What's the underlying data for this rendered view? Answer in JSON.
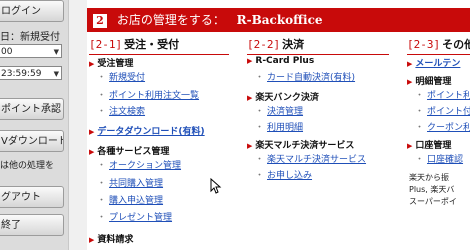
{
  "sidebar": {
    "login_label": "ログイン",
    "new_order_label": "日：新規受付",
    "date_value": "00",
    "time_value": "23:59:59",
    "point_approval_label": "ポイント承認",
    "download_label": "Vダウンロード",
    "note_text": "は他の処理を",
    "logout_label": "グアウト",
    "exit_label": "終了"
  },
  "header": {
    "number": "2",
    "title": "お店の管理をする：",
    "brand": "R-Backoffice"
  },
  "columns": [
    {
      "code": "[2-1]",
      "name": "受注・受付",
      "groups": [
        {
          "label": "受注管理",
          "links": [
            "新規受付",
            "ポイント利用注文一覧",
            "注文検索"
          ]
        },
        {
          "label": "データダウンロード(有料)",
          "links": []
        },
        {
          "label": "各種サービス管理",
          "links": [
            "オークション管理",
            "共同購入管理",
            "購入申込管理",
            "プレゼント管理"
          ]
        },
        {
          "label": "資料請求",
          "links": []
        }
      ]
    },
    {
      "code": "[2-2]",
      "name": "決済",
      "groups": [
        {
          "label": "R-Card Plus",
          "links": [
            "カード自動決済(有料)"
          ]
        },
        {
          "label": "楽天バンク決済",
          "links": [
            "決済管理",
            "利用明細"
          ]
        },
        {
          "label": "楽天マルチ決済サービス",
          "links": [
            "楽天マルチ決済サービス",
            "お申し込み"
          ]
        }
      ]
    },
    {
      "code": "[2-3]",
      "name": "その他",
      "groups": [
        {
          "label": "メールテン",
          "links": []
        },
        {
          "label": "明細管理",
          "links": [
            "ポイント利",
            "ポイント付与",
            "クーポン利"
          ]
        },
        {
          "label": "口座管理",
          "links": [
            "口座確認"
          ]
        }
      ],
      "note_lines": [
        "楽天から振",
        "Plus, 楽天バ",
        "スーパーポイ"
      ]
    }
  ],
  "colors": {
    "accent": "#c80a0a",
    "link": "#1f4fb8"
  }
}
